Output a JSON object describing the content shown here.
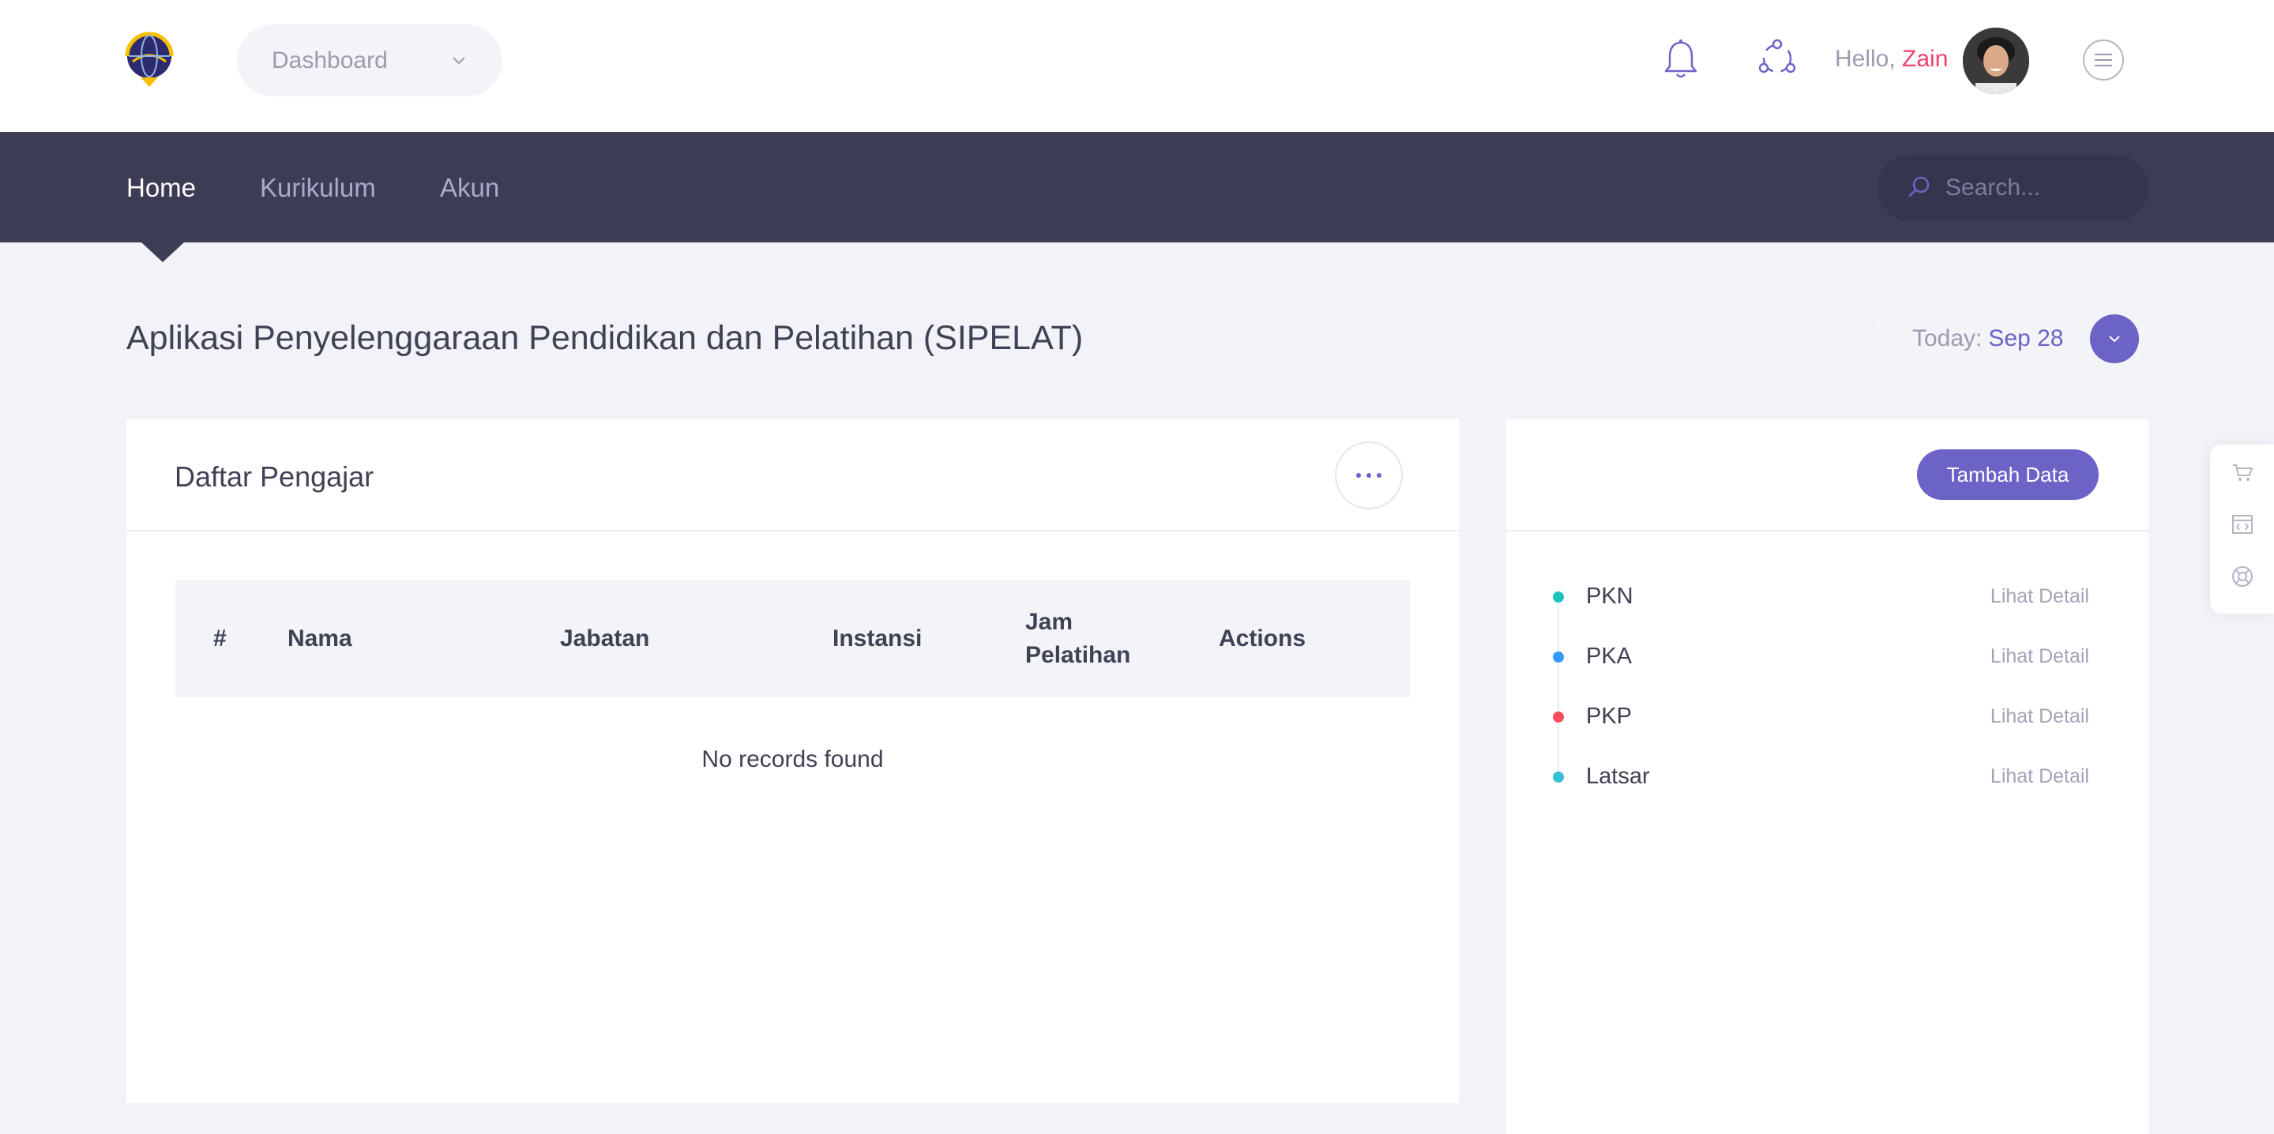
{
  "header": {
    "dashboard_select": "Dashboard",
    "hello_prefix": "Hello,",
    "user_name": "Zain"
  },
  "nav": {
    "items": [
      {
        "label": "Home",
        "active": true
      },
      {
        "label": "Kurikulum",
        "active": false
      },
      {
        "label": "Akun",
        "active": false
      }
    ],
    "search_placeholder": "Search..."
  },
  "page": {
    "title": "Aplikasi Penyelenggaraan Pendidikan dan Pelatihan (SIPELAT)",
    "today_label": "Today:",
    "today_date": "Sep 28"
  },
  "teachers_card": {
    "title": "Daftar Pengajar",
    "columns": [
      "#",
      "Nama",
      "Jabatan",
      "Instansi",
      "Jam Pelatihan",
      "Actions"
    ],
    "rows": [],
    "empty_text": "No records found"
  },
  "programs_card": {
    "add_button": "Tambah Data",
    "items": [
      {
        "label": "PKN",
        "link": "Lihat Detail",
        "color": "#1bc5bd"
      },
      {
        "label": "PKA",
        "link": "Lihat Detail",
        "color": "#3699ff"
      },
      {
        "label": "PKP",
        "link": "Lihat Detail",
        "color": "#f64e60"
      },
      {
        "label": "Latsar",
        "link": "Lihat Detail",
        "color": "#37c0d6"
      }
    ]
  },
  "theme": {
    "accent": "#6c63c7",
    "nav_bg": "#3c3d55",
    "user_name_color": "#f1416c"
  },
  "icons": [
    "logo-icon",
    "chevron-down-icon",
    "bell-icon",
    "network-icon",
    "avatar",
    "hamburger-menu-icon",
    "search-icon",
    "more-dots-icon",
    "cart-icon",
    "code-icon",
    "lifebuoy-icon"
  ]
}
